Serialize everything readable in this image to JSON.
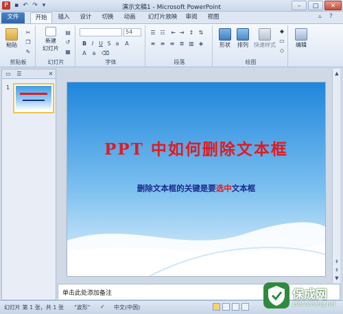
{
  "window": {
    "title": "演示文稿1 - Microsoft PowerPoint",
    "controls": {
      "minimize": "–",
      "maximize": "□",
      "close": "✕"
    }
  },
  "ribbon_tabs": [
    "文件",
    "开始",
    "插入",
    "设计",
    "切换",
    "动画",
    "幻灯片放映",
    "审阅",
    "视图"
  ],
  "ribbon": {
    "clipboard": {
      "label": "剪贴板",
      "paste": "粘贴"
    },
    "slides": {
      "label": "幻灯片",
      "new_slide_1": "新建",
      "new_slide_2": "幻灯片"
    },
    "font": {
      "label": "字体",
      "size": "54"
    },
    "paragraph": {
      "label": "段落"
    },
    "drawing": {
      "label": "绘图",
      "shapes": "形状",
      "arrange": "排列",
      "quick_styles": "快速样式"
    },
    "editing": {
      "label": "编辑",
      "editing": "编辑"
    }
  },
  "left_panel": {
    "slide_number": "1"
  },
  "slide": {
    "title": "PPT 中如何删除文本框",
    "subtitle_before": "删除文本框的关键是要",
    "subtitle_highlight": "选中",
    "subtitle_after": "文本框"
  },
  "notes": {
    "placeholder": "单击此处添加备注"
  },
  "status": {
    "slide_info": "幻灯片 第 1 张，共 1 张",
    "theme": "\"波形\"",
    "language": "中文(中国)"
  },
  "watermark": {
    "brand": "保成网",
    "url": "zsbaocheng.net"
  },
  "colors": {
    "title_red": "#e5191c",
    "subtitle_blue": "#1a2a8c",
    "file_tab": "#2f64a8"
  }
}
